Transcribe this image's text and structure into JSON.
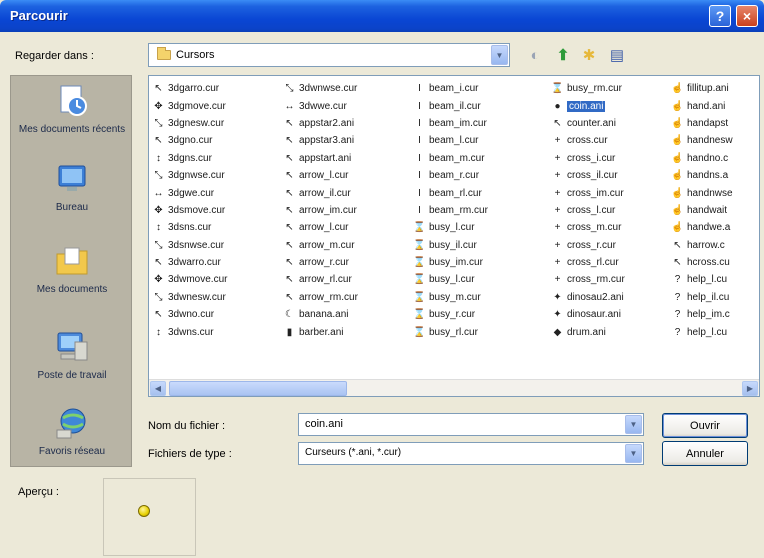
{
  "window": {
    "title": "Parcourir",
    "help_label": "?",
    "close_label": "×"
  },
  "lookin": {
    "label": "Regarder dans :",
    "value": "Cursors"
  },
  "toolbar": {
    "back_icon": "back-icon",
    "up_icon": "up-folder-icon",
    "newfolder_icon": "new-folder-icon",
    "views_icon": "views-icon"
  },
  "places": [
    {
      "label": "Mes documents récents",
      "icon": "recent-documents-icon"
    },
    {
      "label": "Bureau",
      "icon": "desktop-icon"
    },
    {
      "label": "Mes documents",
      "icon": "my-documents-icon"
    },
    {
      "label": "Poste de travail",
      "icon": "my-computer-icon"
    },
    {
      "label": "Favoris réseau",
      "icon": "network-places-icon"
    }
  ],
  "files": {
    "columns": [
      [
        "3dgarro.cur",
        "3dgmove.cur",
        "3dgnesw.cur",
        "3dgno.cur",
        "3dgns.cur",
        "3dgnwse.cur",
        "3dgwe.cur",
        "3dsmove.cur",
        "3dsns.cur",
        "3dsnwse.cur",
        "3dwarro.cur",
        "3dwmove.cur",
        "3dwnesw.cur",
        "3dwno.cur",
        "3dwns.cur"
      ],
      [
        "3dwnwse.cur",
        "3dwwe.cur",
        "appstar2.ani",
        "appstar3.ani",
        "appstart.ani",
        "arrow_l.cur",
        "arrow_il.cur",
        "arrow_im.cur",
        "arrow_l.cur",
        "arrow_m.cur",
        "arrow_r.cur",
        "arrow_rl.cur",
        "arrow_rm.cur",
        "banana.ani",
        "barber.ani"
      ],
      [
        "beam_i.cur",
        "beam_il.cur",
        "beam_im.cur",
        "beam_l.cur",
        "beam_m.cur",
        "beam_r.cur",
        "beam_rl.cur",
        "beam_rm.cur",
        "busy_l.cur",
        "busy_il.cur",
        "busy_im.cur",
        "busy_l.cur",
        "busy_m.cur",
        "busy_r.cur",
        "busy_rl.cur"
      ],
      [
        "busy_rm.cur",
        "coin.ani",
        "counter.ani",
        "cross.cur",
        "cross_i.cur",
        "cross_il.cur",
        "cross_im.cur",
        "cross_l.cur",
        "cross_m.cur",
        "cross_r.cur",
        "cross_rl.cur",
        "cross_rm.cur",
        "dinosau2.ani",
        "dinosaur.ani",
        "drum.ani"
      ],
      [
        "fillitup.ani",
        "hand.ani",
        "handapst",
        "handnesw",
        "handno.c",
        "handns.a",
        "handnwse",
        "handwait",
        "handwe.a",
        "harrow.c",
        "hcross.cu",
        "help_l.cu",
        "help_il.cu",
        "help_im.c",
        "help_l.cu"
      ]
    ],
    "selected": "coin.ani"
  },
  "filename": {
    "label": "Nom du fichier :",
    "value": "coin.ani"
  },
  "filetype": {
    "label": "Fichiers de type :",
    "value": "Curseurs (*.ani, *.cur)"
  },
  "buttons": {
    "open": "Ouvrir",
    "cancel": "Annuler"
  },
  "preview": {
    "label": "Aperçu :"
  },
  "colors": {
    "title_bar": "#0A46D4",
    "selection": "#316AC5",
    "dialog_bg": "#ECE9D8",
    "places_bg": "#B8B4A5"
  }
}
